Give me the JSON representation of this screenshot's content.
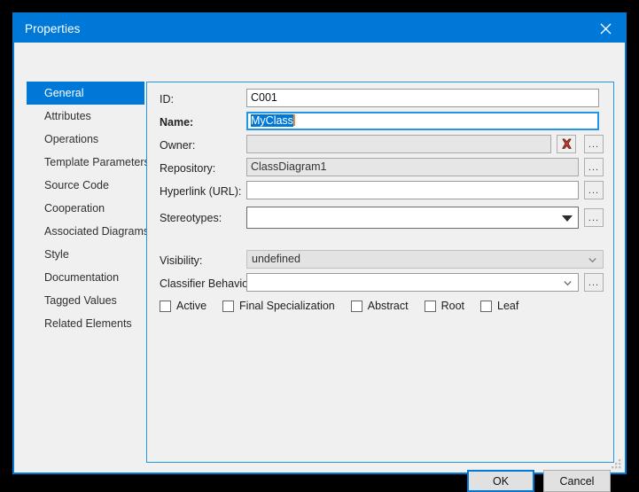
{
  "window": {
    "title": "Properties",
    "close_icon": "close-icon",
    "accent_color": "#0078d7",
    "background_color": "#f0f0f0"
  },
  "sidebar": {
    "items": [
      {
        "label": "General",
        "selected": true
      },
      {
        "label": "Attributes",
        "selected": false
      },
      {
        "label": "Operations",
        "selected": false
      },
      {
        "label": "Template Parameters",
        "selected": false
      },
      {
        "label": "Source Code",
        "selected": false
      },
      {
        "label": "Cooperation",
        "selected": false
      },
      {
        "label": "Associated Diagrams",
        "selected": false
      },
      {
        "label": "Style",
        "selected": false
      },
      {
        "label": "Documentation",
        "selected": false
      },
      {
        "label": "Tagged Values",
        "selected": false
      },
      {
        "label": "Related Elements",
        "selected": false
      }
    ]
  },
  "form": {
    "id": {
      "label": "ID:",
      "value": "C001",
      "placeholder": ""
    },
    "name": {
      "label": "Name:",
      "value": "MyClass",
      "placeholder": ""
    },
    "owner": {
      "label": "Owner:",
      "value": "",
      "placeholder": ""
    },
    "repository": {
      "label": "Repository:",
      "value": "ClassDiagram1",
      "placeholder": ""
    },
    "hyperlink": {
      "label": "Hyperlink (URL):",
      "value": "",
      "placeholder": ""
    },
    "stereotypes": {
      "label": "Stereotypes:",
      "value": "",
      "placeholder": ""
    },
    "visibility": {
      "label": "Visibility:",
      "value": "undefined",
      "placeholder": ""
    },
    "classifier_behavior": {
      "label": "Classifier Behavior:",
      "value": "",
      "placeholder": ""
    },
    "ellipsis_label": "...",
    "clear_icon": "red-x-icon",
    "dropdown_icon": "chevron-down-icon"
  },
  "checkboxes": [
    {
      "label": "Active",
      "checked": false
    },
    {
      "label": "Final Specialization",
      "checked": false
    },
    {
      "label": "Abstract",
      "checked": false
    },
    {
      "label": "Root",
      "checked": false
    },
    {
      "label": "Leaf",
      "checked": false
    }
  ],
  "footer": {
    "ok_label": "OK",
    "cancel_label": "Cancel"
  }
}
